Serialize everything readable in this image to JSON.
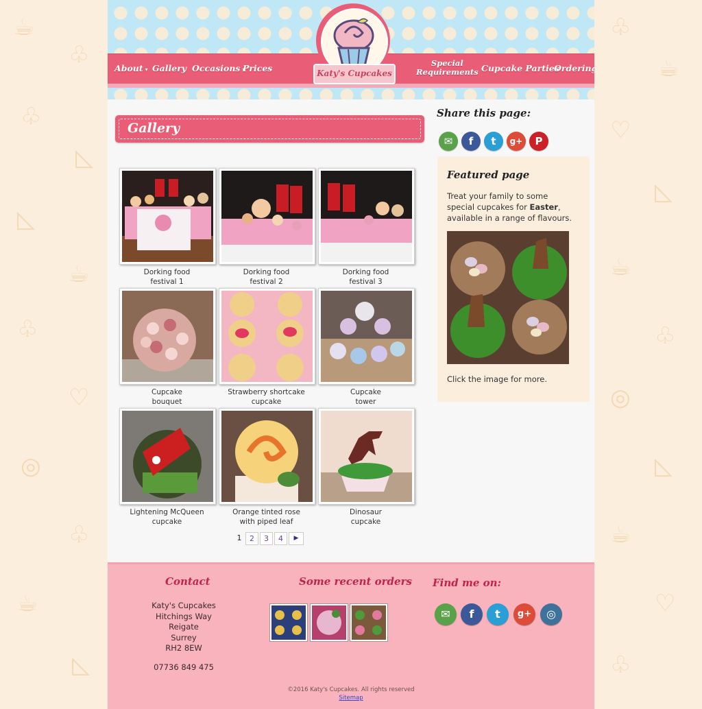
{
  "brand": {
    "logo_text": "Katy's Cupcakes"
  },
  "nav": {
    "about": "About",
    "gallery": "Gallery",
    "occasions": "Occasions",
    "prices": "Prices",
    "special_line1": "Special",
    "special_line2": "Requirements",
    "parties": "Cupcake Parties",
    "ordering": "Ordering"
  },
  "main": {
    "title": "Gallery",
    "items": [
      {
        "line1": "Dorking food",
        "line2": "festival 1"
      },
      {
        "line1": "Dorking food",
        "line2": "festival 2"
      },
      {
        "line1": "Dorking food",
        "line2": "festival 3"
      },
      {
        "line1": "Cupcake",
        "line2": "bouquet"
      },
      {
        "line1": "Strawberry shortcake",
        "line2": "cupcake"
      },
      {
        "line1": "Cupcake",
        "line2": "tower"
      },
      {
        "line1": "Lightening McQueen",
        "line2": "cupcake"
      },
      {
        "line1": "Orange tinted rose",
        "line2": "with piped leaf"
      },
      {
        "line1": "Dinosaur",
        "line2": "cupcake"
      }
    ],
    "pagination": {
      "current": "1",
      "pages": [
        "2",
        "3",
        "4"
      ],
      "next": "▶"
    }
  },
  "sidebar": {
    "share_title": "Share this page:",
    "featured_title": "Featured page",
    "featured_text_1": "Treat your family to some special cupcakes for ",
    "featured_bold": "Easter",
    "featured_text_2": ", available in a range of flavours.",
    "click_more": "Click the image for more.",
    "share_icons": [
      "email-icon",
      "facebook-icon",
      "twitter-icon",
      "google-plus-icon",
      "pinterest-icon"
    ]
  },
  "footer": {
    "contact_title": "Contact",
    "address": [
      "Katy's Cupcakes",
      "Hitchings Way",
      "Reigate",
      "Surrey",
      "RH2 8EW"
    ],
    "phone": "07736 849 475",
    "orders_title": "Some recent orders",
    "find_title": "Find me on:",
    "find_icons": [
      "email-icon",
      "facebook-icon",
      "twitter-icon",
      "google-plus-icon",
      "instagram-icon"
    ],
    "copyright": "©2016 Katy's Cupcakes. All rights reserved",
    "sitemap": "Sitemap"
  },
  "colors": {
    "page_bg": "#fbeedd",
    "nav_pink": "#e95e76",
    "header_blue": "#bfe7f6",
    "footer_pink": "#f9b3bd",
    "footer_heading": "#c0244a"
  }
}
